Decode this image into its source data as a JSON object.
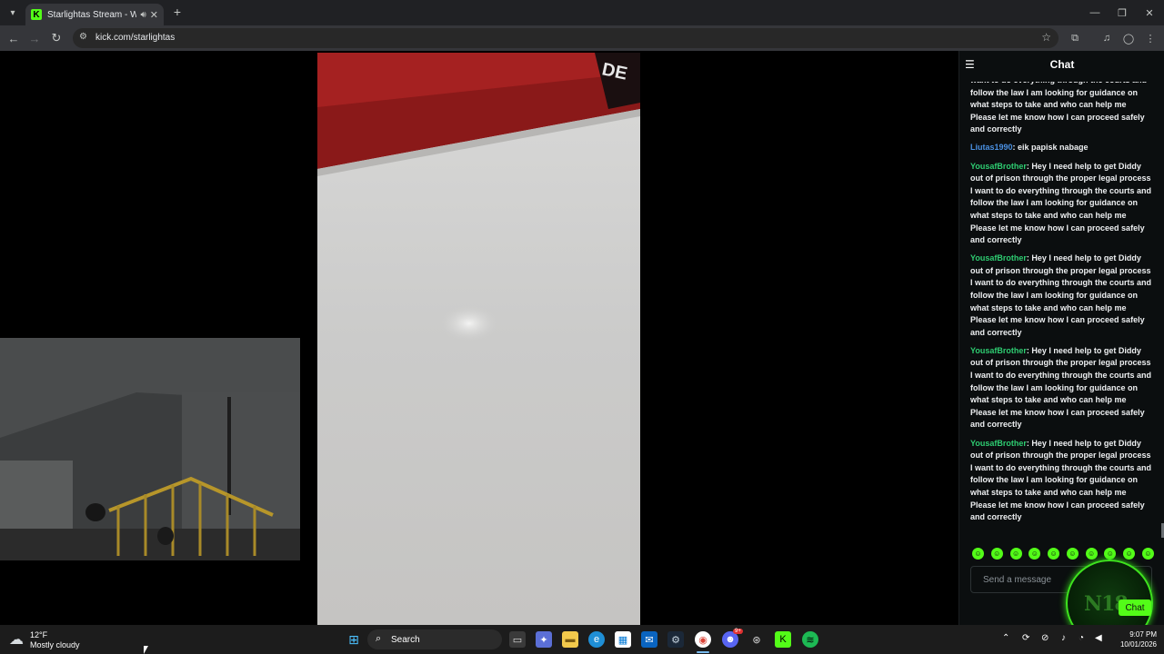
{
  "browser": {
    "tab_title": "Starlightas Stream - Watch l",
    "tab_favicon": "K",
    "url": "kick.com/starlightas",
    "icons": {
      "tab_list": "chevron-down-icon",
      "audio": "speaker-icon",
      "close_tab": "close-icon",
      "new_tab": "plus-icon",
      "back": "back-arrow-icon",
      "forward": "forward-arrow-icon",
      "reload": "reload-icon",
      "site_info": "tune-icon",
      "bookmark": "star-icon",
      "extensions": "puzzle-icon",
      "media": "media-control-icon",
      "profile": "profile-icon",
      "menu": "kebab-menu-icon",
      "minimize": "minimize-icon",
      "maximize": "restore-icon",
      "close_window": "close-icon"
    }
  },
  "chat": {
    "title": "Chat",
    "partial_message_tail": "want to do everything through the courts and follow the law I am looking for guidance on what steps to take and who can help me Please let me know how I can proceed safely and correctly",
    "messages": [
      {
        "user": "Liutas1990",
        "user_color": "#4a90e2",
        "text": ": eik papisk nabage"
      },
      {
        "user": "YousafBrother",
        "user_color": "#2ecc71",
        "text": ": Hey I need help to get Diddy out of prison through the proper legal process I want to do everything through the courts and follow the law I am looking for guidance on what steps to take and who can help me Please let me know how I can proceed safely and correctly"
      },
      {
        "user": "YousafBrother",
        "user_color": "#2ecc71",
        "text": ": Hey I need help to get Diddy out of prison through the proper legal process I want to do everything through the courts and follow the law I am looking for guidance on what steps to take and who can help me Please let me know how I can proceed safely and correctly"
      },
      {
        "user": "YousafBrother",
        "user_color": "#2ecc71",
        "text": ": Hey I need help to get Diddy out of prison through the proper legal process I want to do everything through the courts and follow the law I am looking for guidance on what steps to take and who can help me Please let me know how I can proceed safely and correctly"
      },
      {
        "user": "YousafBrother",
        "user_color": "#2ecc71",
        "text": ": Hey I need help to get Diddy out of prison through the proper legal process I want to do everything through the courts and follow the law I am looking for guidance on what steps to take and who can help me Please let me know how I can proceed safely and correctly"
      }
    ],
    "input_placeholder": "Send a message",
    "emote_count": 10,
    "accent_color": "#53fc18"
  },
  "overlay": {
    "badge_text": "N18",
    "chat_button": "Chat"
  },
  "taskbar": {
    "weather_temp": "12°F",
    "weather_desc": "Mostly cloudy",
    "search_label": "Search",
    "time": "9:07 PM",
    "date": "10/01/2026",
    "apps": [
      "windows-start-icon",
      "search-icon",
      "task-view-icon",
      "copilot-icon",
      "file-explorer-icon",
      "edge-icon",
      "store-icon",
      "outlook-icon",
      "steam-icon",
      "chrome-icon",
      "discord-icon",
      "xbox-icon",
      "kick-icon",
      "spotify-icon"
    ],
    "discord_badge": "9+"
  }
}
